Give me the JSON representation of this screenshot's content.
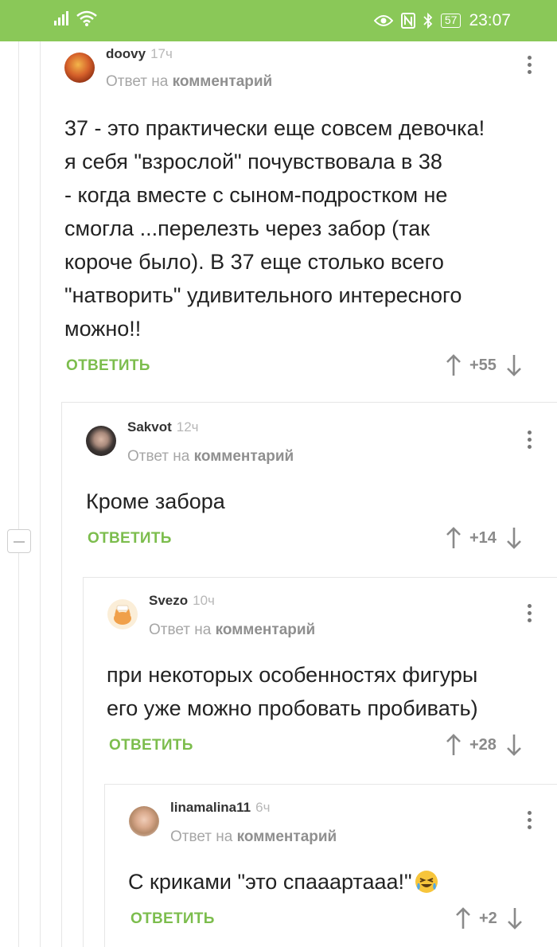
{
  "status_bar": {
    "battery": "57",
    "time": "23:07"
  },
  "strings": {
    "reply_to_prefix": "Ответ на",
    "reply_to_link": "комментарий",
    "reply_button": "ОТВЕТИТЬ"
  },
  "comments": [
    {
      "author": "doovy",
      "time": "17ч",
      "text": [
        "37 - это практически еще совсем девочка!",
        "я себя \"взрослой\" почувствовала в 38",
        "- когда вместе с сыном-подростком не",
        "смогла ...перелезть через забор (так",
        "короче было). В 37 еще столько всего",
        "\"натворить\" удивительного  интересного",
        "можно!!"
      ],
      "score": "+55"
    },
    {
      "author": "Sakvot",
      "time": "12ч",
      "text": [
        "Кроме забора"
      ],
      "score": "+14"
    },
    {
      "author": "Svezo",
      "time": "10ч",
      "text": [
        "при некоторых особенностях фигуры",
        "его уже можно пробовать пробивать)"
      ],
      "score": "+28"
    },
    {
      "author": "linamalina11",
      "time": "6ч",
      "text": [
        "С криками \"это спааартааа!\""
      ],
      "score": "+2"
    }
  ],
  "colors": {
    "status_bar_bg": "#8ac858",
    "reply_button": "#7cbd4d",
    "score": "#8a8a8a"
  }
}
